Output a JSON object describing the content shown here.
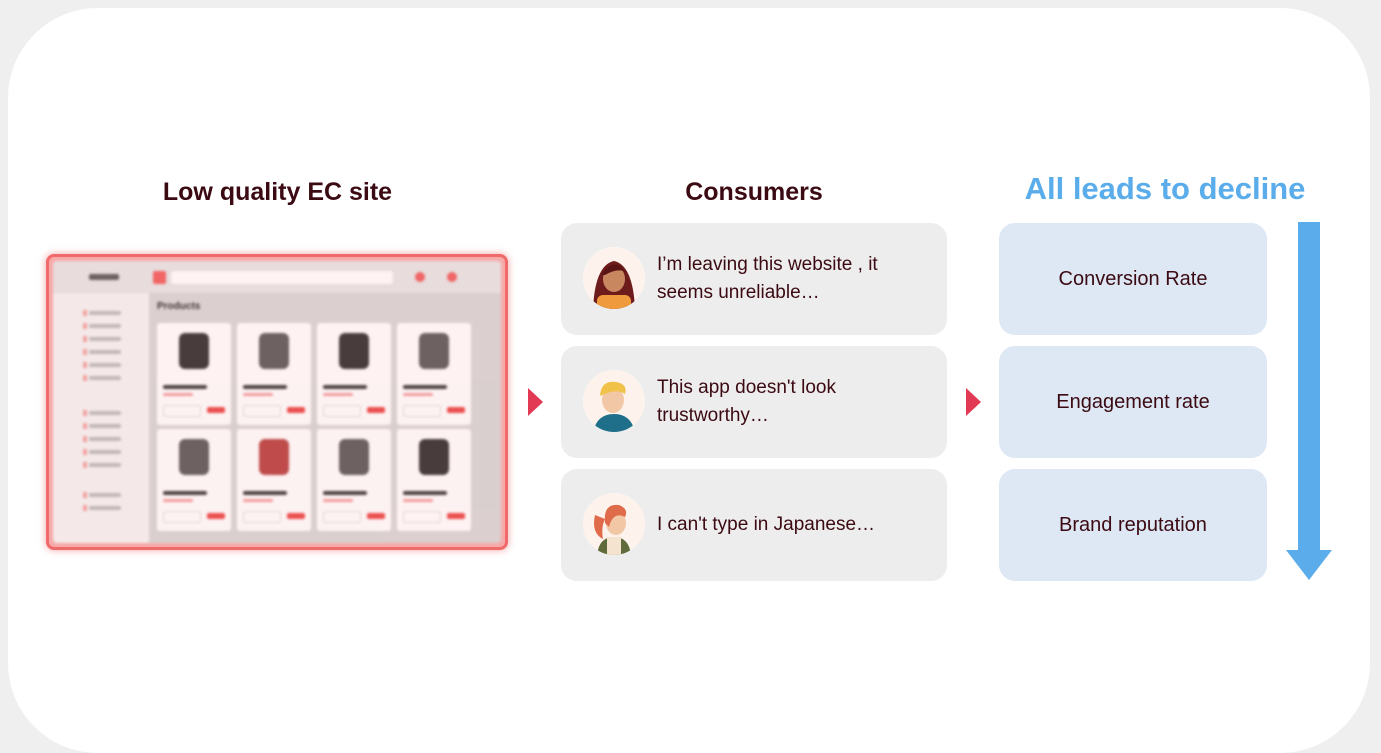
{
  "headings": {
    "ec_site": "Low quality EC site",
    "consumers": "Consumers",
    "decline": "All leads to decline"
  },
  "mock_site": {
    "section_title": "Products"
  },
  "consumers": [
    {
      "avatar": "woman-dark-hair-avatar",
      "quote": "I’m leaving this website , it seems unreliable…"
    },
    {
      "avatar": "man-blond-hair-avatar",
      "quote": "This app doesn't look trustworthy…"
    },
    {
      "avatar": "woman-red-ponytail-avatar",
      "quote": "I can't type in Japanese…"
    }
  ],
  "metrics": [
    "Conversion Rate",
    "Engagement rate",
    "Brand reputation"
  ],
  "colors": {
    "heading": "#3b0a12",
    "decline_accent": "#5aadea",
    "triangle": "#e23a55",
    "ec_frame": "#f06a6a",
    "bubble_bg": "#ededed",
    "metric_bg": "#dde8f4"
  }
}
